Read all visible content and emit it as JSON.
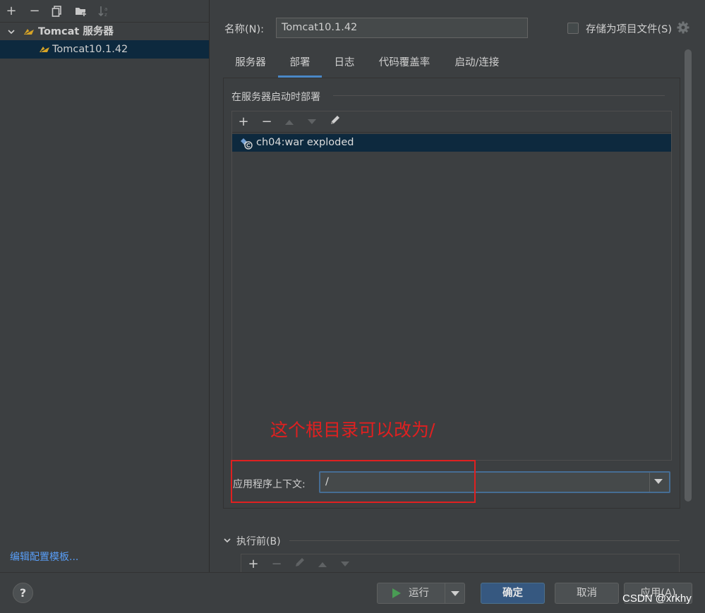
{
  "tree": {
    "group_label": "Tomcat 服务器",
    "item_label": "Tomcat10.1.42"
  },
  "left_footer": {
    "edit_templates": "编辑配置模板..."
  },
  "form": {
    "name_label": "名称(N):",
    "name_value": "Tomcat10.1.42",
    "store_label": "存储为项目文件(S)",
    "store_checked": false
  },
  "tabs": [
    {
      "label": "服务器",
      "active": false
    },
    {
      "label": "部署",
      "active": true
    },
    {
      "label": "日志",
      "active": false
    },
    {
      "label": "代码覆盖率",
      "active": false
    },
    {
      "label": "启动/连接",
      "active": false
    }
  ],
  "deploy": {
    "heading": "在服务器启动时部署",
    "artifacts": [
      "ch04:war exploded"
    ],
    "context_label": "应用程序上下文:",
    "context_value": "/"
  },
  "annotation": {
    "text": "这个根目录可以改为/",
    "color": "#e02020"
  },
  "before_launch": {
    "label": "执行前(B)"
  },
  "buttons": {
    "help": "?",
    "run": "运行",
    "ok": "确定",
    "cancel": "取消",
    "apply": "应用(A)"
  },
  "watermark": "CSDN @xrkhy",
  "colors": {
    "background": "#3c3f41",
    "selection": "#0d293e",
    "accent": "#4a88c7",
    "primary_button": "#365880",
    "link": "#589df6"
  }
}
